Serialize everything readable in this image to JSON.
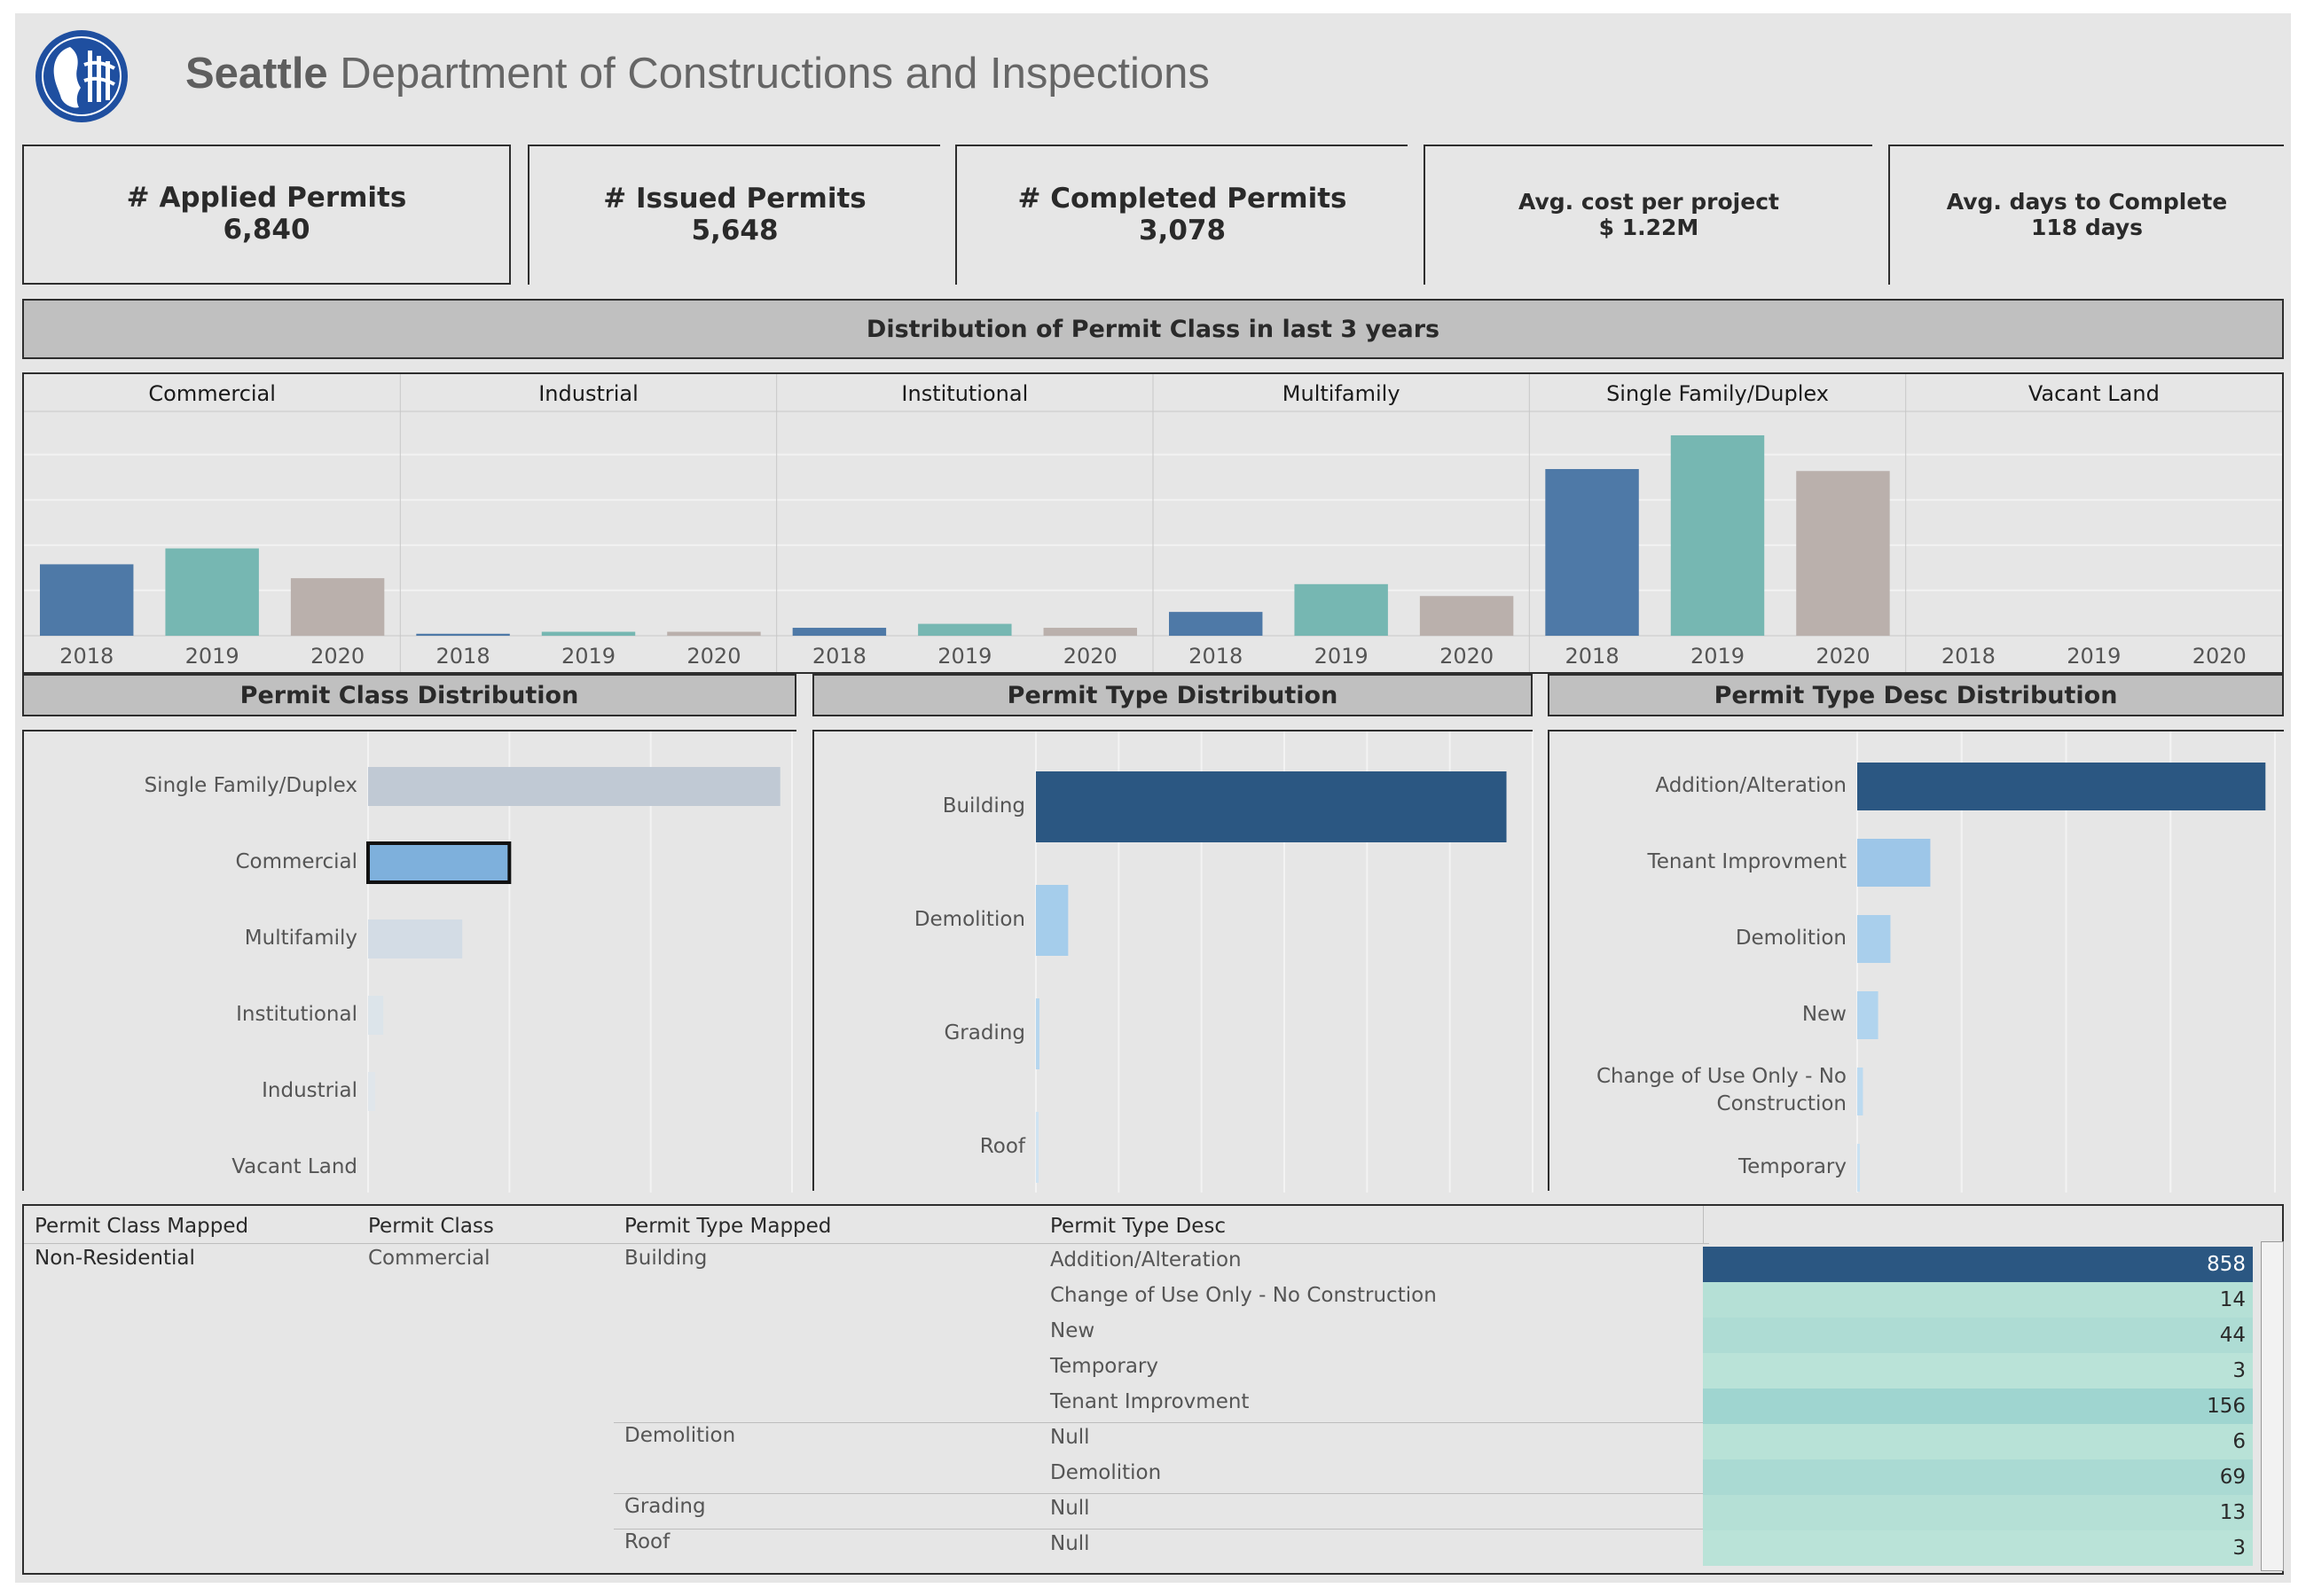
{
  "header": {
    "logo_icon": "seattle-seal-icon",
    "title_bold": "Seattle",
    "title_rest": " Department of Constructions and Inspections"
  },
  "kpis": [
    {
      "label": "# Applied Permits",
      "value": "6,840"
    },
    {
      "label": "# Issued Permits",
      "value": "5,648"
    },
    {
      "label": "# Completed Permits",
      "value": "3,078"
    },
    {
      "label": "Avg. cost per project",
      "value": "$ 1.22M"
    },
    {
      "label": "Avg. days to Complete",
      "value": "118 days"
    }
  ],
  "sections": {
    "dist_title": "Distribution of Permit Class in last 3 years",
    "class_title": "Permit Class Distribution",
    "type_title": "Permit Type Distribution",
    "desc_title": "Permit Type Desc Distribution"
  },
  "colors": {
    "y2018": "#4e79a7",
    "y2019": "#76b7b2",
    "y2020": "#bab0ac",
    "dark_blue": "#2b5782",
    "mid_blue": "#7eb0dc",
    "light_blue": "#9dc6e8"
  },
  "chart_data": [
    {
      "type": "bar",
      "title": "Distribution of Permit Class in last 3 years",
      "categories": [
        "Commercial",
        "Industrial",
        "Institutional",
        "Multifamily",
        "Single Family/Duplex",
        "Vacant Land"
      ],
      "x_ticks": [
        "2018",
        "2019",
        "2020"
      ],
      "series": [
        {
          "name": "2018",
          "values": [
            36,
            1,
            4,
            12,
            84,
            0
          ]
        },
        {
          "name": "2019",
          "values": [
            44,
            2,
            6,
            26,
            101,
            0
          ]
        },
        {
          "name": "2020",
          "values": [
            29,
            2,
            4,
            20,
            83,
            0
          ]
        }
      ],
      "ylim": [
        0,
        105
      ],
      "grid": true
    },
    {
      "type": "bar",
      "orientation": "horizontal",
      "title": "Permit Class Distribution",
      "categories": [
        "Single Family/Duplex",
        "Commercial",
        "Multifamily",
        "Institutional",
        "Industrial",
        "Vacant Land"
      ],
      "values": [
        3500,
        1200,
        800,
        130,
        60,
        0
      ],
      "xlim": [
        0,
        3600
      ],
      "highlighted": "Commercial",
      "grid": true
    },
    {
      "type": "bar",
      "orientation": "horizontal",
      "title": "Permit Type Distribution",
      "categories": [
        "Building",
        "Demolition",
        "Grading",
        "Roof"
      ],
      "values": [
        5400,
        370,
        40,
        8
      ],
      "xlim": [
        0,
        5700
      ],
      "grid": true
    },
    {
      "type": "bar",
      "orientation": "horizontal",
      "title": "Permit Type Desc Distribution",
      "categories": [
        "Addition/Alteration",
        "Tenant Improvment",
        "Demolition",
        "New",
        "Change of Use Only - No Construction",
        "Temporary"
      ],
      "values": [
        4300,
        770,
        350,
        220,
        60,
        10
      ],
      "xlim": [
        0,
        4400
      ],
      "grid": true
    }
  ],
  "table": {
    "headers": [
      "Permit Class Mapped",
      "Permit Class",
      "Permit Type Mapped",
      "Permit Type Desc"
    ],
    "class_mapped": "Non-Residential",
    "class": "Commercial",
    "rows": [
      {
        "type": "Building",
        "desc": "Addition/Alteration",
        "value": "858",
        "num": 858
      },
      {
        "type": "",
        "desc": "Change of Use Only - No Construction",
        "value": "14",
        "num": 14
      },
      {
        "type": "",
        "desc": "New",
        "value": "44",
        "num": 44
      },
      {
        "type": "",
        "desc": "Temporary",
        "value": "3",
        "num": 3
      },
      {
        "type": "",
        "desc": "Tenant Improvment",
        "value": "156",
        "num": 156
      },
      {
        "type": "Demolition",
        "desc": "Null",
        "value": "6",
        "num": 6
      },
      {
        "type": "",
        "desc": "Demolition",
        "value": "69",
        "num": 69
      },
      {
        "type": "Grading",
        "desc": "Null",
        "value": "13",
        "num": 13
      },
      {
        "type": "Roof",
        "desc": "Null",
        "value": "3",
        "num": 3
      }
    ]
  }
}
